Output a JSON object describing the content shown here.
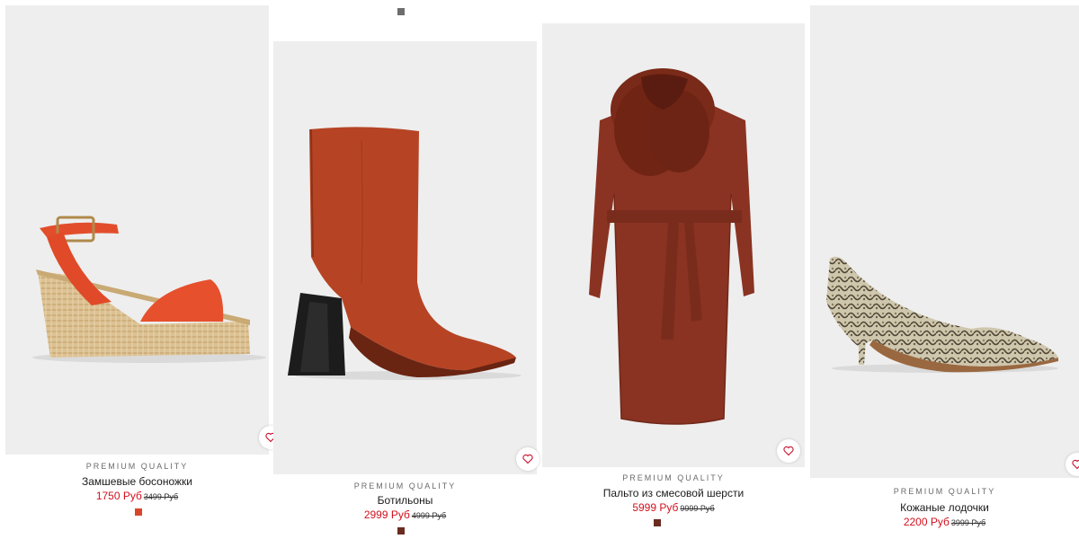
{
  "colors": {
    "sale_price": "#d2101e",
    "photo_bg": "#eeeeee",
    "swatch_top": "#6d6d6d"
  },
  "products": [
    {
      "quality": "PREMIUM QUALITY",
      "name": "Замшевые босоножки",
      "price": "1750 Руб",
      "old_price": "3499 Руб",
      "swatch_color": "#d8462a",
      "image": "orange-suede-espadrille-wedge-sandal",
      "favorite_icon": "heart-icon"
    },
    {
      "quality": "PREMIUM QUALITY",
      "name": "Ботильоны",
      "price": "2999 Руб",
      "old_price": "4999 Руб",
      "swatch_color": "#6a2c1f",
      "image": "rust-suede-block-heel-ankle-boot",
      "favorite_icon": "heart-icon"
    },
    {
      "quality": "PREMIUM QUALITY",
      "name": "Пальто из смесовой шерсти",
      "price": "5999 Руб",
      "old_price": "9999 Руб",
      "swatch_color": "#6a2c1f",
      "image": "rust-wool-coat-with-faux-fur-collar",
      "favorite_icon": "heart-icon"
    },
    {
      "quality": "PREMIUM QUALITY",
      "name": "Кожаные лодочки",
      "price": "2200 Руб",
      "old_price": "3999 Руб",
      "swatch_color": "#000000",
      "image": "snakeskin-kitten-heel-pump",
      "favorite_icon": "heart-icon"
    }
  ]
}
